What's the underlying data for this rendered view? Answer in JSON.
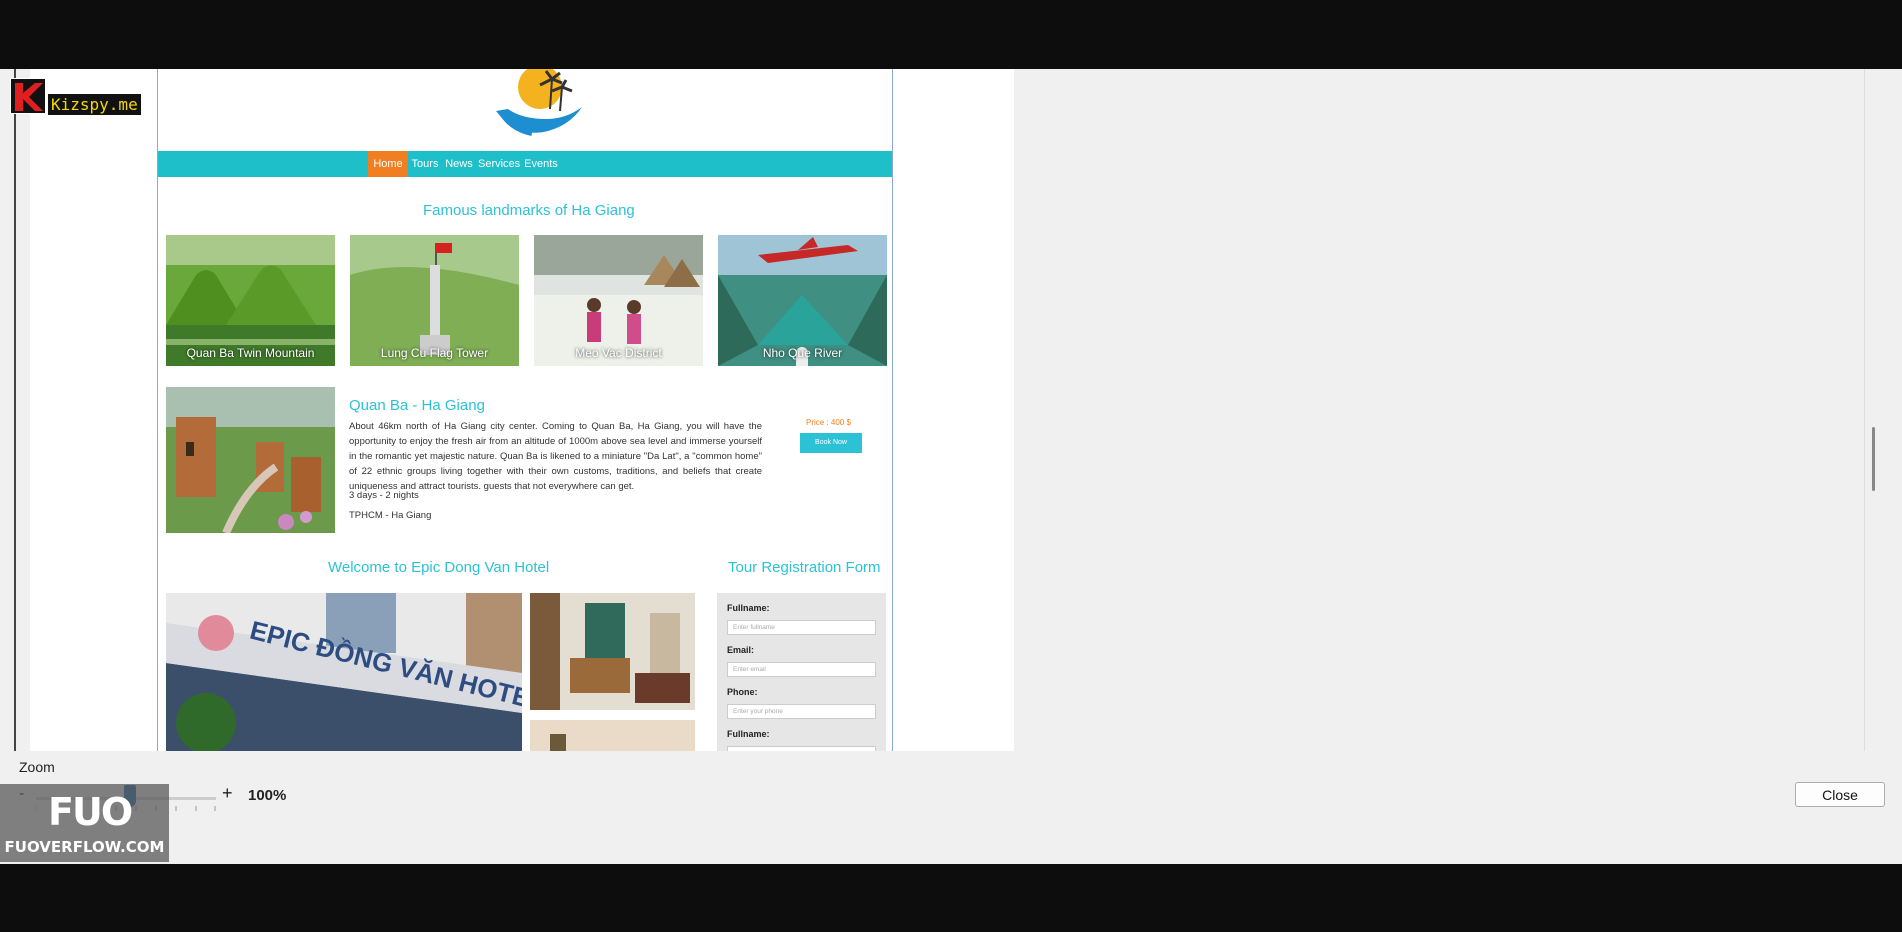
{
  "site": {
    "nav": [
      "Home",
      "Tours",
      "News",
      "Services",
      "Events"
    ],
    "landmarks_title": "Famous landmarks of Ha Giang",
    "landmarks": [
      {
        "name": "Quan Ba Twin Mountain"
      },
      {
        "name": "Lung Cu Flag Tower"
      },
      {
        "name": "Meo Vac District"
      },
      {
        "name": "Nho Que River"
      }
    ],
    "tour": {
      "title": "Quan Ba - Ha Giang",
      "description": "About 46km north of Ha Giang city center. Coming to Quan Ba, Ha Giang, you will have the opportunity to enjoy the fresh air from an altitude of 1000m above sea level and immerse yourself in the romantic yet majestic nature. Quan Ba is likened to a miniature \"Da Lat\", a \"common home\" of 22 ethnic groups living together with their own customs, traditions, and beliefs that create uniqueness and attract tourists. guests that not everywhere can get.",
      "duration": "3 days - 2 nights",
      "route": "TPHCM - Ha Giang",
      "price": "Price : 400 $",
      "book_label": "Book Now"
    },
    "hotel_title": "Welcome to Epic Dong Van Hotel",
    "hotel_sign": "EPIC ĐỒNG VĂN HOTEL",
    "form": {
      "title": "Tour Registration Form",
      "fields": [
        {
          "label": "Fullname:",
          "placeholder": "Enter fullname"
        },
        {
          "label": "Email:",
          "placeholder": "Enter email"
        },
        {
          "label": "Phone:",
          "placeholder": "Enter your phone"
        },
        {
          "label": "Fullname:",
          "placeholder": ""
        }
      ]
    }
  },
  "zoom": {
    "label": "Zoom",
    "minus": "-",
    "plus": "+",
    "value": "100%",
    "level_percent": 100
  },
  "close_label": "Close",
  "watermarks": {
    "kizspy": "Kizspy.me",
    "fuo_logo": "FUO",
    "fuo_text": "FUOVERFLOW.COM"
  },
  "colors": {
    "accent": "#2cc2d6",
    "nav_bg": "#1fbfc9",
    "nav_active": "#f07f22",
    "price": "#f07f22"
  }
}
